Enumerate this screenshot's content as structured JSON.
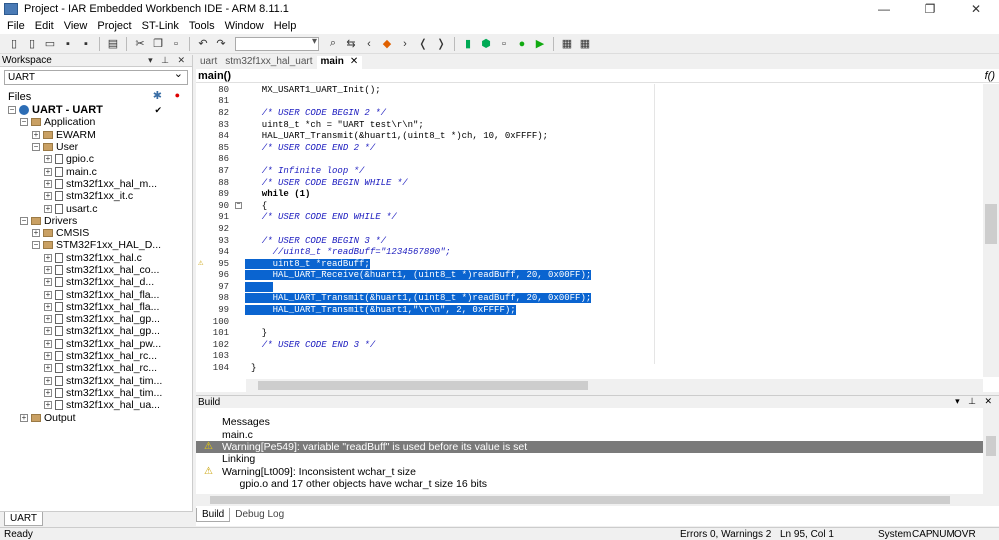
{
  "window": {
    "title": "Project - IAR Embedded Workbench IDE - ARM 8.11.1",
    "minimize": "—",
    "restore": "❐",
    "close": "✕"
  },
  "menu": [
    "File",
    "Edit",
    "View",
    "Project",
    "ST-Link",
    "Tools",
    "Window",
    "Help"
  ],
  "workspace": {
    "header": "Workspace",
    "config": "UART",
    "files_label": "Files",
    "bottom_tab": "UART",
    "tree": [
      {
        "label": "UART - UART",
        "level": 0,
        "type": "project",
        "exp": "⊟",
        "check": "✔"
      },
      {
        "label": "Application",
        "level": 1,
        "type": "folder",
        "exp": "⊟"
      },
      {
        "label": "EWARM",
        "level": 2,
        "type": "folder",
        "exp": "⊞"
      },
      {
        "label": "User",
        "level": 2,
        "type": "folder",
        "exp": "⊟"
      },
      {
        "label": "gpio.c",
        "level": 3,
        "type": "file",
        "exp": "⊞"
      },
      {
        "label": "main.c",
        "level": 3,
        "type": "file",
        "exp": "⊞"
      },
      {
        "label": "stm32f1xx_hal_m...",
        "level": 3,
        "type": "file",
        "exp": "⊞"
      },
      {
        "label": "stm32f1xx_it.c",
        "level": 3,
        "type": "file",
        "exp": "⊞"
      },
      {
        "label": "usart.c",
        "level": 3,
        "type": "file",
        "exp": "⊞"
      },
      {
        "label": "Drivers",
        "level": 1,
        "type": "folder",
        "exp": "⊟"
      },
      {
        "label": "CMSIS",
        "level": 2,
        "type": "folder",
        "exp": "⊞"
      },
      {
        "label": "STM32F1xx_HAL_D...",
        "level": 2,
        "type": "folder",
        "exp": "⊟"
      },
      {
        "label": "stm32f1xx_hal.c",
        "level": 3,
        "type": "file",
        "exp": "⊞"
      },
      {
        "label": "stm32f1xx_hal_co...",
        "level": 3,
        "type": "file",
        "exp": "⊞"
      },
      {
        "label": "stm32f1xx_hal_d...",
        "level": 3,
        "type": "file",
        "exp": "⊞"
      },
      {
        "label": "stm32f1xx_hal_fla...",
        "level": 3,
        "type": "file",
        "exp": "⊞"
      },
      {
        "label": "stm32f1xx_hal_fla...",
        "level": 3,
        "type": "file",
        "exp": "⊞"
      },
      {
        "label": "stm32f1xx_hal_gp...",
        "level": 3,
        "type": "file",
        "exp": "⊞"
      },
      {
        "label": "stm32f1xx_hal_gp...",
        "level": 3,
        "type": "file",
        "exp": "⊞"
      },
      {
        "label": "stm32f1xx_hal_pw...",
        "level": 3,
        "type": "file",
        "exp": "⊞"
      },
      {
        "label": "stm32f1xx_hal_rc...",
        "level": 3,
        "type": "file",
        "exp": "⊞"
      },
      {
        "label": "stm32f1xx_hal_rc...",
        "level": 3,
        "type": "file",
        "exp": "⊞"
      },
      {
        "label": "stm32f1xx_hal_tim...",
        "level": 3,
        "type": "file",
        "exp": "⊞"
      },
      {
        "label": "stm32f1xx_hal_tim...",
        "level": 3,
        "type": "file",
        "exp": "⊞"
      },
      {
        "label": "stm32f1xx_hal_ua...",
        "level": 3,
        "type": "file",
        "exp": "⊞"
      },
      {
        "label": "Output",
        "level": 1,
        "type": "folder",
        "exp": "⊞"
      }
    ]
  },
  "editor": {
    "tabs": [
      {
        "label": "uart",
        "active": false
      },
      {
        "label": "stm32f1xx_hal_uart",
        "active": false
      },
      {
        "label": "main",
        "active": true,
        "close": "✕"
      }
    ],
    "function": "main()",
    "fn_icon": "f()",
    "lines": [
      {
        "n": "80",
        "code": "  MX_USART1_UART_Init();",
        "k": "plain"
      },
      {
        "n": "81",
        "code": "",
        "k": "plain"
      },
      {
        "n": "82",
        "code": "  /* USER CODE BEGIN 2 */",
        "k": "cm"
      },
      {
        "n": "83",
        "code": "  uint8_t *ch = \"UART test\\r\\n\";",
        "k": "plain"
      },
      {
        "n": "84",
        "code": "  HAL_UART_Transmit(&huart1,(uint8_t *)ch, 10, 0xFFFF);",
        "k": "plain"
      },
      {
        "n": "85",
        "code": "  /* USER CODE END 2 */",
        "k": "cm"
      },
      {
        "n": "86",
        "code": "",
        "k": "plain"
      },
      {
        "n": "87",
        "code": "  /* Infinite loop */",
        "k": "cm"
      },
      {
        "n": "88",
        "code": "  /* USER CODE BEGIN WHILE */",
        "k": "cm"
      },
      {
        "n": "89",
        "code": "  while (1)",
        "k": "kw"
      },
      {
        "n": "90",
        "code": "  {",
        "k": "plain",
        "fold": "⊟"
      },
      {
        "n": "91",
        "code": "  /* USER CODE END WHILE */",
        "k": "cm"
      },
      {
        "n": "92",
        "code": "",
        "k": "plain"
      },
      {
        "n": "93",
        "code": "  /* USER CODE BEGIN 3 */",
        "k": "cm"
      },
      {
        "n": "94",
        "code": "    //uint8_t *readBuff=\"1234567890\";",
        "k": "cm"
      },
      {
        "n": "95",
        "code": "    uint8_t *readBuff;",
        "k": "sel",
        "warn": "⚠"
      },
      {
        "n": "96",
        "code": "    HAL_UART_Receive(&huart1, (uint8_t *)readBuff, 20, 0x00FF);",
        "k": "sel"
      },
      {
        "n": "97",
        "code": "    ",
        "k": "sel"
      },
      {
        "n": "98",
        "code": "    HAL_UART_Transmit(&huart1,(uint8_t *)readBuff, 20, 0x00FF);",
        "k": "sel"
      },
      {
        "n": "99",
        "code": "    HAL_UART_Transmit(&huart1,\"\\r\\n\", 2, 0xFFFF);",
        "k": "sel"
      },
      {
        "n": "100",
        "code": "",
        "k": "plain"
      },
      {
        "n": "101",
        "code": "  }",
        "k": "plain"
      },
      {
        "n": "102",
        "code": "  /* USER CODE END 3 */",
        "k": "cm"
      },
      {
        "n": "103",
        "code": "",
        "k": "plain"
      },
      {
        "n": "104",
        "code": "}",
        "k": "plain"
      }
    ]
  },
  "build": {
    "header": "Build",
    "messages": [
      {
        "text": "Messages",
        "icon": "",
        "hl": false
      },
      {
        "text": "main.c",
        "icon": "",
        "hl": false
      },
      {
        "text": "Warning[Pe549]: variable \"readBuff\" is used before its value is set",
        "icon": "⚠",
        "hl": true
      },
      {
        "text": "Linking",
        "icon": "",
        "hl": false
      },
      {
        "text": "Warning[Lt009]: Inconsistent wchar_t size",
        "icon": "⚠",
        "hl": false
      },
      {
        "text": "      gpio.o and 17 other objects have wchar_t size 16 bits",
        "icon": "",
        "hl": false
      }
    ],
    "tabs": [
      "Build",
      "Debug Log"
    ]
  },
  "status": {
    "ready": "Ready",
    "errors": "Errors 0, Warnings 2",
    "position": "Ln 95, Col 1",
    "system": "System",
    "cap": "CAP",
    "num": "NUM",
    "ovr": "OVR"
  }
}
